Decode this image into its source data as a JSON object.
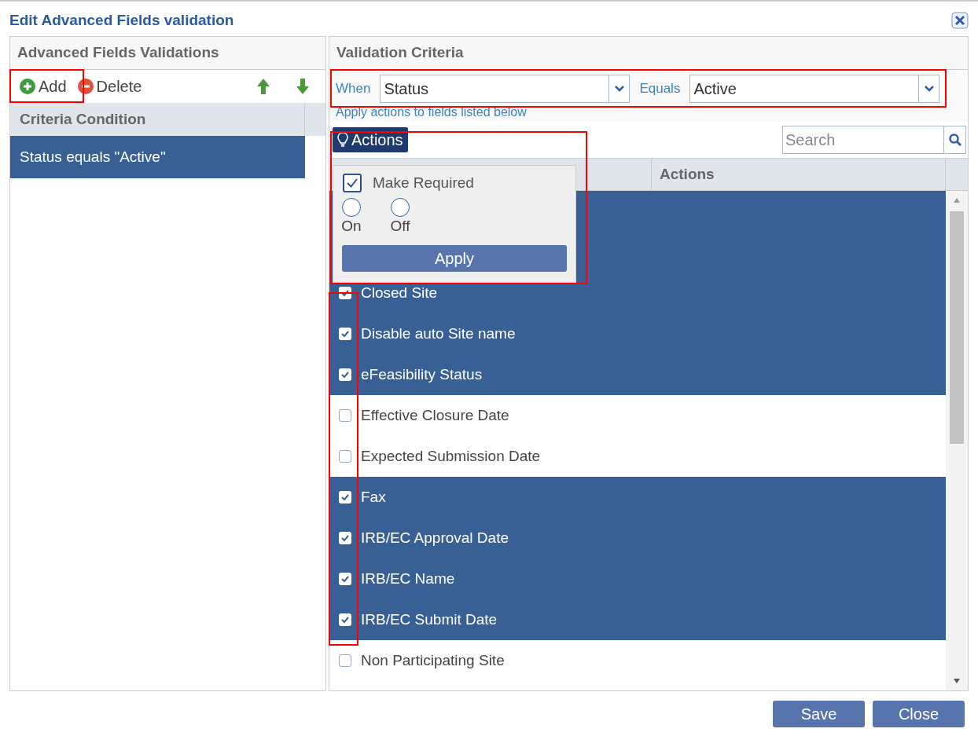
{
  "dialog": {
    "title": "Edit Advanced Fields validation"
  },
  "left_panel": {
    "title": "Advanced Fields Validations",
    "add_button": "Add",
    "delete_button": "Delete",
    "column": "Criteria Condition",
    "rows": [
      {
        "text": "Status equals \"Active\"",
        "selected": true
      }
    ]
  },
  "right_panel": {
    "title": "Validation Criteria",
    "when_label": "When",
    "when_value": "Status",
    "equals_label": "Equals",
    "equals_value": "Active",
    "hint": "Apply actions to fields listed below",
    "actions_button": "Actions",
    "search": {
      "placeholder": "Search"
    },
    "actions_column": "Actions",
    "rows": [
      {
        "label": "Closed Site",
        "checked": true
      },
      {
        "label": "Disable auto Site name",
        "checked": true
      },
      {
        "label": "eFeasibility Status",
        "checked": true
      },
      {
        "label": "Effective Closure Date",
        "checked": false
      },
      {
        "label": "Expected Submission Date",
        "checked": false
      },
      {
        "label": "Fax",
        "checked": true
      },
      {
        "label": "IRB/EC Approval Date",
        "checked": true
      },
      {
        "label": "IRB/EC Name",
        "checked": true
      },
      {
        "label": "IRB/EC Submit Date",
        "checked": true
      },
      {
        "label": "Non Participating Site",
        "checked": false
      }
    ]
  },
  "actions_popup": {
    "option": "Make Required",
    "checked": true,
    "radios": [
      {
        "label": "On",
        "selected": false
      },
      {
        "label": "Off",
        "selected": false
      }
    ],
    "apply_button": "Apply"
  },
  "footer": {
    "buttons": [
      "Save",
      "Close"
    ]
  }
}
